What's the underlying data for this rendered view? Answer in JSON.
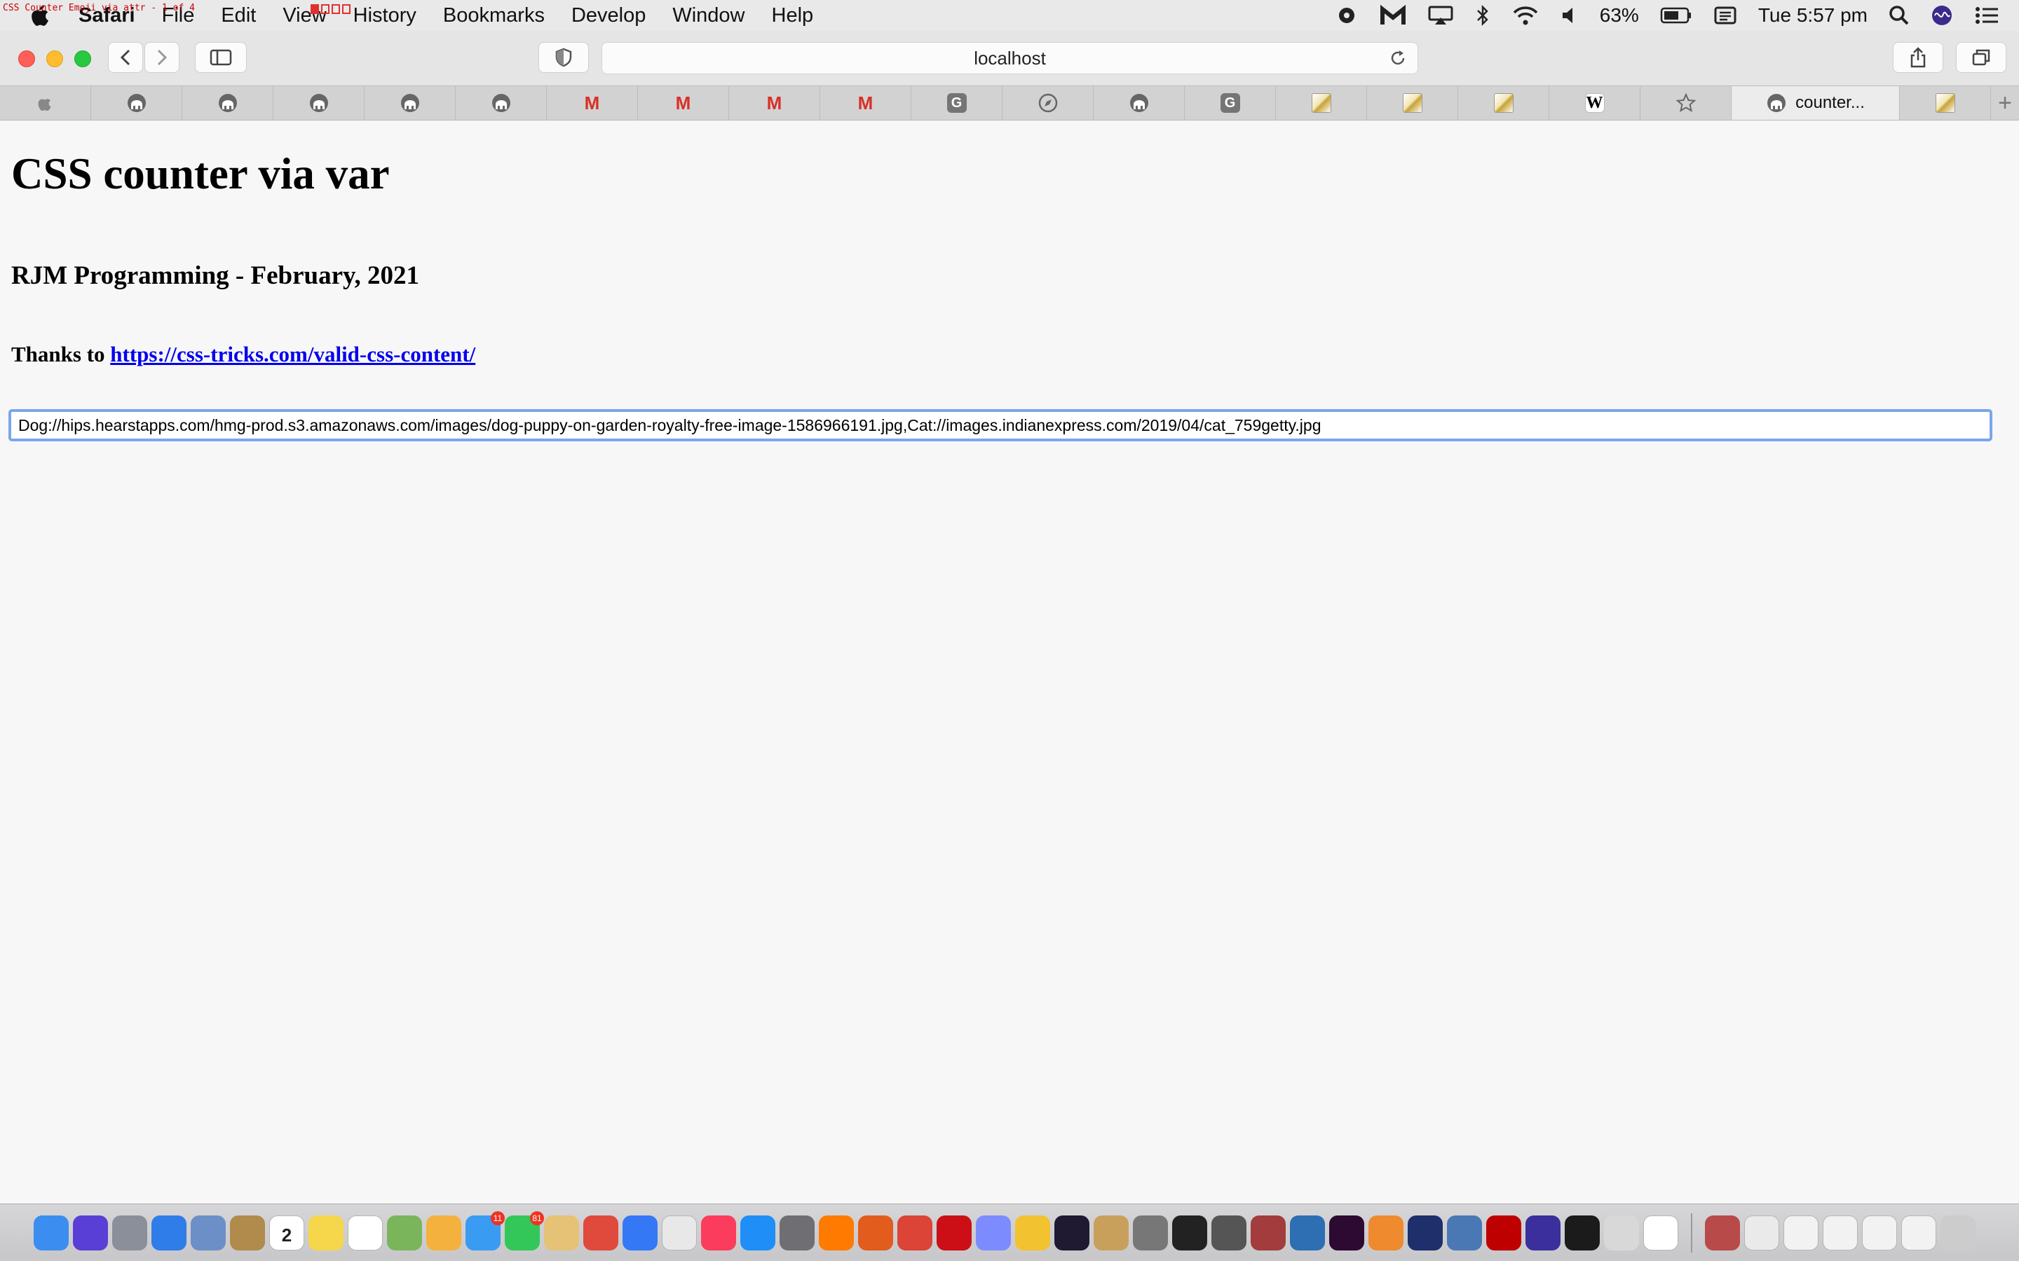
{
  "menubar": {
    "overlay_text": "CSS Counter Emoji via attr - 1 of 4",
    "app_name": "Safari",
    "items": [
      "File",
      "Edit",
      "View",
      "History",
      "Bookmarks",
      "Develop",
      "Window",
      "Help"
    ],
    "battery_percent": "63%",
    "clock": "Tue 5:57 pm"
  },
  "toolbar": {
    "address": "localhost"
  },
  "tabs": {
    "active_label": "counter...",
    "favicons": [
      "apple-icon",
      "elephant-icon",
      "elephant-icon",
      "elephant-icon",
      "elephant-icon",
      "elephant-icon",
      "gmail-icon",
      "gmail-icon",
      "gmail-icon",
      "gmail-icon",
      "google-icon",
      "compass-icon",
      "elephant-icon",
      "google-icon",
      "image-icon",
      "image-icon",
      "image-icon",
      "wikipedia-icon",
      "star-icon"
    ],
    "favicon_text": {
      "google": "G",
      "wikipedia": "W",
      "gmail": "M"
    }
  },
  "page": {
    "title": "CSS counter via var",
    "subtitle": "RJM Programming - February, 2021",
    "thanks_prefix": "Thanks to ",
    "thanks_link": "https://css-tricks.com/valid-css-content/",
    "input_value": "Dog://hips.hearstapps.com/hmg-prod.s3.amazonaws.com/images/dog-puppy-on-garden-royalty-free-image-1586966191.jpg,Cat://images.indianexpress.com/2019/04/cat_759getty.jpg"
  },
  "dock": {
    "calendar_day": "2",
    "badges": {
      "messages": "11",
      "facetime": "81"
    },
    "icon_colors": [
      "#3b8ef0",
      "#5a3fd6",
      "#8a8f99",
      "#2f7de8",
      "#6d8fc8",
      "#b08b4c",
      "#ffffff",
      "#f6d64a",
      "#ffffff",
      "#7ab55c",
      "#f4b13e",
      "#3a9bf3",
      "#33c759",
      "#e6c277",
      "#e04a3c",
      "#3478f6",
      "#e8e8e8",
      "#fb3c5d",
      "#1f8ff7",
      "#6e6e73",
      "#ff7a00",
      "#e25c1e",
      "#db4437",
      "#cc0f16",
      "#7c8cff",
      "#f2c230",
      "#1f1a32",
      "#c9a05b",
      "#777777",
      "#222222",
      "#555555",
      "#a33c3c",
      "#2e6eb3",
      "#2d0a32",
      "#f08a2e",
      "#1e2f6b",
      "#4a78b4",
      "#bf0000",
      "#3a2f9c",
      "#1b1b1b",
      "#d8d8d8",
      "#ffffff",
      "#b84a4a",
      "#eaeaea",
      "#f2f2f2",
      "#f2f2f2",
      "#f2f2f2",
      "#f2f2f2",
      "#cccccc"
    ]
  },
  "colors": {
    "link": "#0000ee",
    "focus_ring": "#7aa6ec",
    "close": "#fe5f57",
    "minimize": "#febc2e",
    "zoom": "#28c840"
  }
}
